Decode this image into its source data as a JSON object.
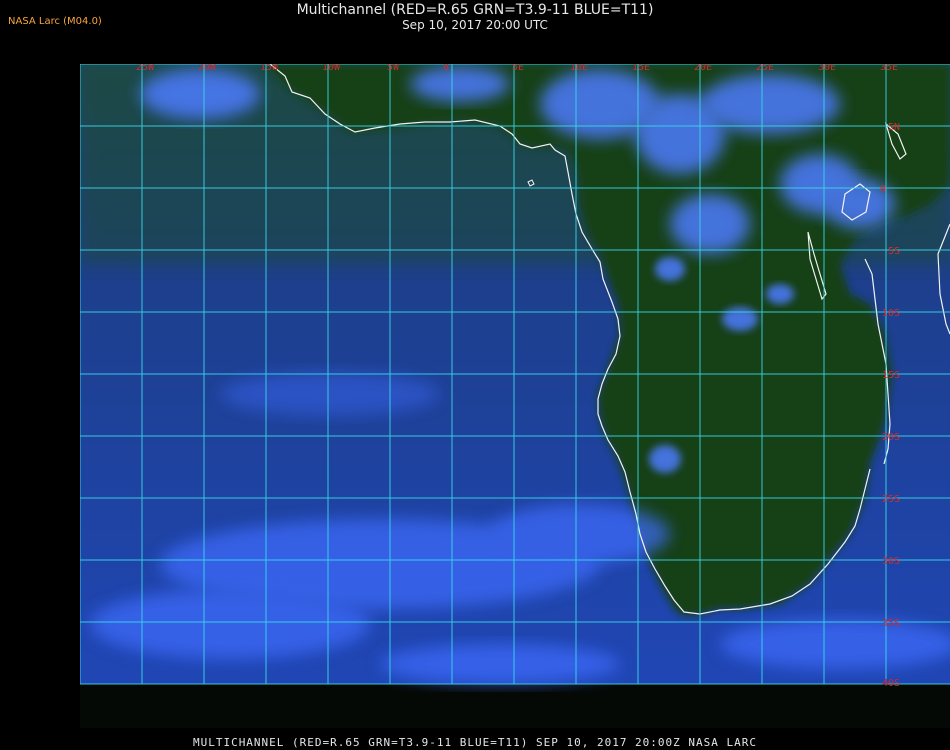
{
  "header": {
    "badge": "NASA Larc (M04.0)",
    "title": "Multichannel (RED=R.65 GRN=T3.9-11 BLUE=T11)",
    "subtitle": "Sep 10, 2017 20:00 UTC"
  },
  "map": {
    "longitude_labels": [
      "25W",
      "20W",
      "15W",
      "10W",
      "5W",
      "0",
      "5E",
      "10E",
      "15E",
      "20E",
      "25E",
      "30E",
      "35E"
    ],
    "latitude_labels": [
      "5N",
      "0",
      "5S",
      "10S",
      "15S",
      "20S",
      "25S",
      "30S",
      "35S",
      "40S"
    ],
    "colors": {
      "grid": "#39d9ea",
      "coastline": "#f2f2f2",
      "labels": "#d42a2a",
      "ocean": "#1f3fa4",
      "land": "#17401a",
      "cloud": "#4d7bff"
    }
  },
  "footer": {
    "caption": "MULTICHANNEL (RED=R.65 GRN=T3.9-11 BLUE=T11) SEP 10, 2017 20:00Z  NASA LARC"
  }
}
